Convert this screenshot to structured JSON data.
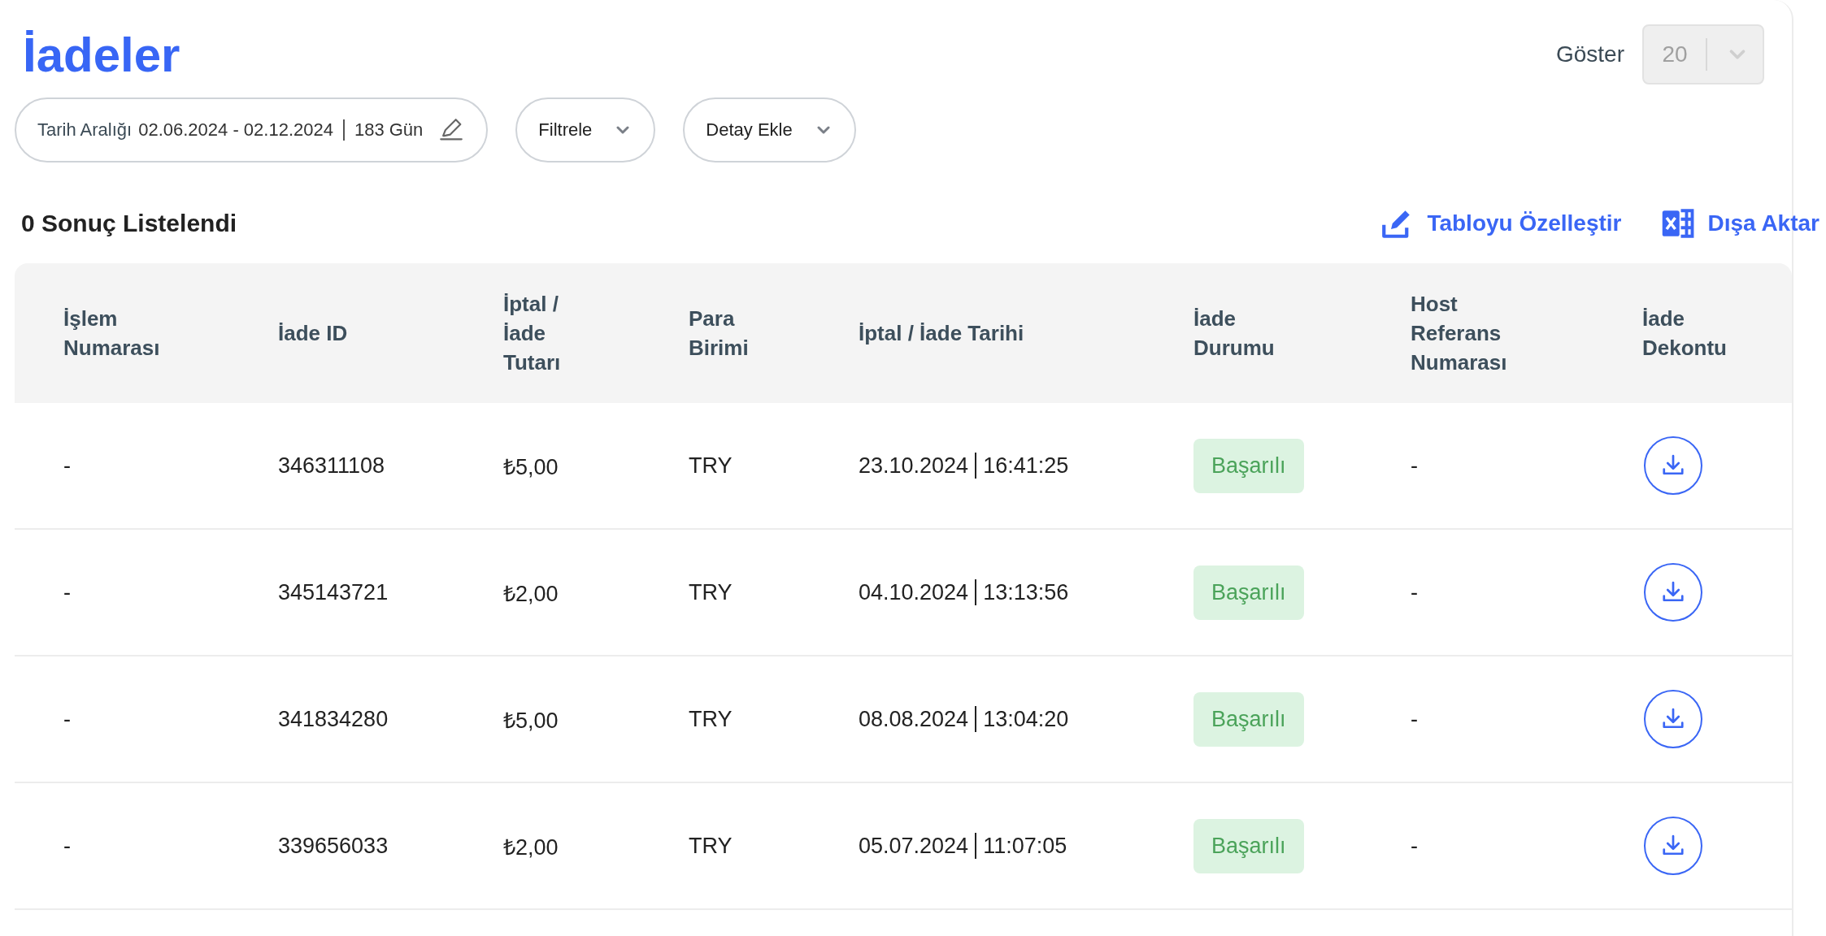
{
  "title": "İadeler",
  "page_size": {
    "label": "Göster",
    "value": "20"
  },
  "date_filter": {
    "label": "Tarih Aralığı",
    "range": "02.06.2024 - 02.12.2024",
    "days": "183 Gün"
  },
  "dropdowns": [
    "Filtrele",
    "Detay Ekle"
  ],
  "result_count": "0 Sonuç Listelendi",
  "actions": [
    {
      "kind": "customize",
      "label": "Tabloyu Özelleştir"
    },
    {
      "kind": "export",
      "label": "Dışa Aktar"
    }
  ],
  "table": {
    "columns": [
      "İşlem Numarası",
      "İade ID",
      "İptal / İade Tutarı",
      "Para Birimi",
      "İptal / İade Tarihi",
      "İade Durumu",
      "Host Referans Numarası",
      "İade Dekontu"
    ],
    "rows": [
      {
        "transaction_no": "-",
        "refund_id": "346311108",
        "amount": "₺5,00",
        "currency": "TRY",
        "date": "23.10.2024",
        "time": "16:41:25",
        "status": "Başarılı",
        "host_ref": "-"
      },
      {
        "transaction_no": "-",
        "refund_id": "345143721",
        "amount": "₺2,00",
        "currency": "TRY",
        "date": "04.10.2024",
        "time": "13:13:56",
        "status": "Başarılı",
        "host_ref": "-"
      },
      {
        "transaction_no": "-",
        "refund_id": "341834280",
        "amount": "₺5,00",
        "currency": "TRY",
        "date": "08.08.2024",
        "time": "13:04:20",
        "status": "Başarılı",
        "host_ref": "-"
      },
      {
        "transaction_no": "-",
        "refund_id": "339656033",
        "amount": "₺2,00",
        "currency": "TRY",
        "date": "05.07.2024",
        "time": "11:07:05",
        "status": "Başarılı",
        "host_ref": "-"
      }
    ]
  }
}
